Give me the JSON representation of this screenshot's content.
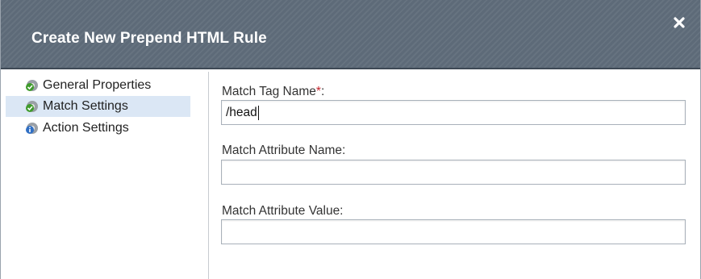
{
  "dialog": {
    "title": "Create New Prepend HTML Rule",
    "close_icon": "close-x-icon"
  },
  "sidebar": {
    "items": [
      {
        "label": "General Properties",
        "icon": "green-check-gear-icon",
        "selected": false
      },
      {
        "label": "Match Settings",
        "icon": "green-check-gear-icon",
        "selected": true
      },
      {
        "label": "Action Settings",
        "icon": "blue-info-gear-icon",
        "selected": false
      }
    ]
  },
  "form": {
    "tag_name": {
      "label": "Match Tag Name",
      "required_mark": "*",
      "suffix": ":",
      "value": "/head"
    },
    "attr_name": {
      "label": "Match Attribute Name:",
      "value": ""
    },
    "attr_value": {
      "label": "Match Attribute Value:",
      "value": ""
    }
  },
  "colors": {
    "titlebar": "#5d6a78",
    "selected_item": "#dbe7f5",
    "required": "#c4262e"
  }
}
